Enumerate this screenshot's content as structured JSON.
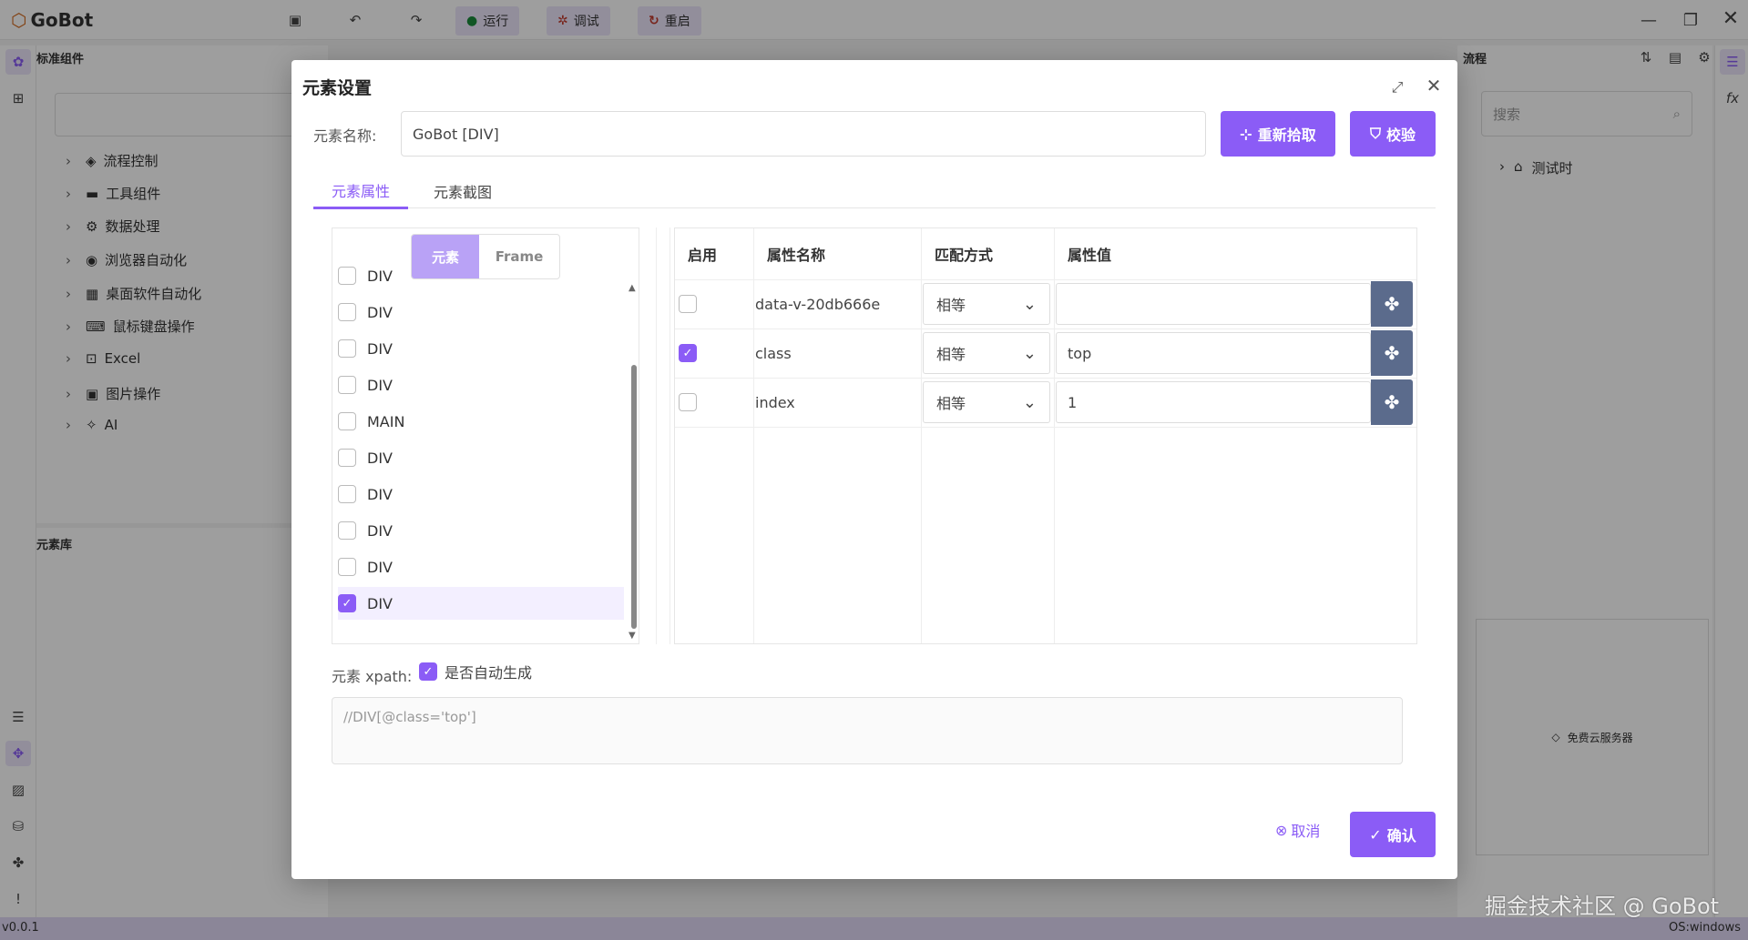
{
  "app": {
    "logo": "GoBot",
    "toolbar": {
      "run": "运行",
      "debug": "调试",
      "restart": "重启"
    },
    "version": "v0.0.1",
    "os": "OS:windows",
    "watermark": "掘金技术社区 @ GoBot"
  },
  "left_panel": {
    "title": "标准组件",
    "search_placeholder": "",
    "items": [
      "流程控制",
      "工具组件",
      "数据处理",
      "浏览器自动化",
      "桌面软件自动化",
      "鼠标键盘操作",
      "Excel",
      "图片操作",
      "AI"
    ]
  },
  "lib_panel": {
    "title": "元素库"
  },
  "right_panel": {
    "title": "流程",
    "search_placeholder": "搜索",
    "items": [
      "测试时"
    ],
    "cloud_label": "免费云服务器"
  },
  "dialog": {
    "title": "元素设置",
    "name_label": "元素名称:",
    "name_value": "GoBot  [DIV]",
    "repick_button": "重新拾取",
    "verify_button": "校验",
    "tabs": [
      "元素属性",
      "元素截图"
    ],
    "active_tab": 0,
    "tree_toggle": [
      "元素",
      "Frame"
    ],
    "tree_nodes": [
      {
        "label": "DIV",
        "checked": false
      },
      {
        "label": "DIV",
        "checked": false
      },
      {
        "label": "DIV",
        "checked": false
      },
      {
        "label": "DIV",
        "checked": false
      },
      {
        "label": "MAIN",
        "checked": false
      },
      {
        "label": "DIV",
        "checked": false
      },
      {
        "label": "DIV",
        "checked": false
      },
      {
        "label": "DIV",
        "checked": false
      },
      {
        "label": "DIV",
        "checked": false
      },
      {
        "label": "DIV",
        "checked": true
      }
    ],
    "table": {
      "headers": [
        "启用",
        "属性名称",
        "匹配方式",
        "属性值"
      ],
      "rows": [
        {
          "enabled": false,
          "name": "data-v-20db666e",
          "match": "相等",
          "value": ""
        },
        {
          "enabled": true,
          "name": "class",
          "match": "相等",
          "value": "top"
        },
        {
          "enabled": false,
          "name": "index",
          "match": "相等",
          "value": "1"
        }
      ]
    },
    "xpath_label": "元素 xpath:",
    "auto_gen_label": "是否自动生成",
    "auto_gen_checked": true,
    "xpath_value": "//DIV[@class='top']",
    "cancel_button": "取消",
    "confirm_button": "确认"
  },
  "colors": {
    "accent": "#8b5cf6",
    "py_button": "#5b6b8c"
  }
}
